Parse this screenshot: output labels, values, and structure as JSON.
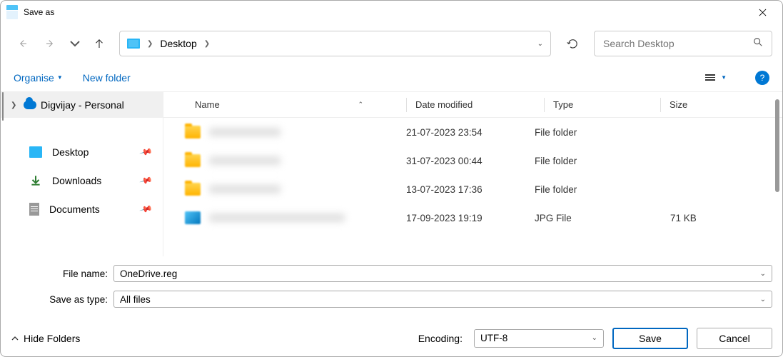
{
  "titlebar": {
    "title": "Save as"
  },
  "nav": {
    "crumb": "Desktop",
    "search_placeholder": "Search Desktop"
  },
  "toolbar": {
    "organise": "Organise",
    "new_folder": "New folder"
  },
  "sidebar": {
    "personal": "Digvijay - Personal",
    "shortcuts": [
      {
        "label": "Desktop"
      },
      {
        "label": "Downloads"
      },
      {
        "label": "Documents"
      }
    ]
  },
  "list": {
    "col_name": "Name",
    "col_date": "Date modified",
    "col_type": "Type",
    "col_size": "Size",
    "rows": [
      {
        "date": "21-07-2023 23:54",
        "type": "File folder",
        "size": ""
      },
      {
        "date": "31-07-2023 00:44",
        "type": "File folder",
        "size": ""
      },
      {
        "date": "13-07-2023 17:36",
        "type": "File folder",
        "size": ""
      },
      {
        "date": "17-09-2023 19:19",
        "type": "JPG File",
        "size": "71 KB"
      }
    ]
  },
  "inputs": {
    "file_name_label": "File name:",
    "file_name_value": "OneDrive.reg",
    "save_as_type_label": "Save as type:",
    "save_as_type_value": "All files"
  },
  "footer": {
    "hide_folders": "Hide Folders",
    "encoding_label": "Encoding:",
    "encoding_value": "UTF-8",
    "save": "Save",
    "cancel": "Cancel"
  }
}
